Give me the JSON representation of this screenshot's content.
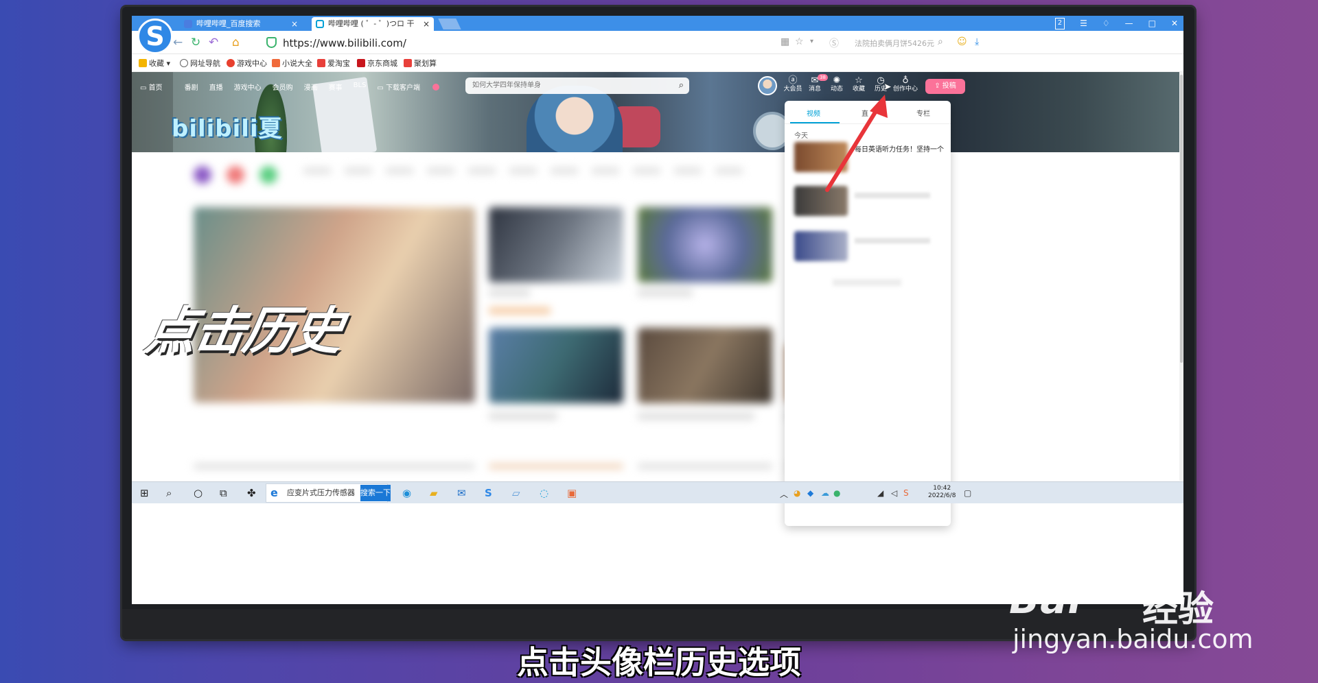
{
  "browser": {
    "tabs": [
      {
        "label": "哔哩哔哩_百度搜索",
        "active": false
      },
      {
        "label": "哔哩哔哩 ( ゜- ゜)つロ 干",
        "active": true
      }
    ],
    "url": "https://www.bilibili.com/",
    "search_hint": "法院拍卖俩月饼5426元",
    "window_badge": "2",
    "bookmarks": [
      "收藏",
      "网址导航",
      "游戏中心",
      "小说大全",
      "爱淘宝",
      "京东商城",
      "聚划算"
    ]
  },
  "bili_header": {
    "nav": [
      "首页",
      "番剧",
      "直播",
      "游戏中心",
      "会员购",
      "漫画",
      "赛事",
      "BLS",
      "下载客户端"
    ],
    "search_placeholder": "如何大学四年保持单身",
    "logo_text": "bilibili夏",
    "icons": [
      {
        "label": "大会员",
        "icon": "vip-icon",
        "count": ""
      },
      {
        "label": "消息",
        "icon": "message-icon",
        "count": "38"
      },
      {
        "label": "动态",
        "icon": "dynamic-icon",
        "count": ""
      },
      {
        "label": "收藏",
        "icon": "star-icon",
        "count": ""
      },
      {
        "label": "历史",
        "icon": "clock-icon",
        "count": ""
      },
      {
        "label": "创作中心",
        "icon": "bulb-icon",
        "count": ""
      }
    ],
    "upload_label": "投稿"
  },
  "history_popup": {
    "tabs": [
      "视频",
      "直",
      "专栏"
    ],
    "active_tab": "视频",
    "section": "今天",
    "items": [
      {
        "title": "每日英语听力任务！坚持一个"
      },
      {
        "title": ""
      },
      {
        "title": ""
      },
      {
        "title": ""
      }
    ]
  },
  "overlay": {
    "caption": "点击历史",
    "subtitle": "点击头像栏历史选项"
  },
  "taskbar": {
    "search_text": "应变片式压力传感器",
    "search_button": "搜索一下",
    "time": "10:42",
    "date": "2022/6/8"
  },
  "watermark": {
    "brand": "Bai",
    "brand_cn": "经验",
    "url": "jingyan.baidu.com"
  },
  "colors": {
    "tabbar": "#3d8fe8",
    "bili_pink": "#fb7299",
    "bili_blue": "#00a1d6",
    "arrow": "#e8353a"
  }
}
